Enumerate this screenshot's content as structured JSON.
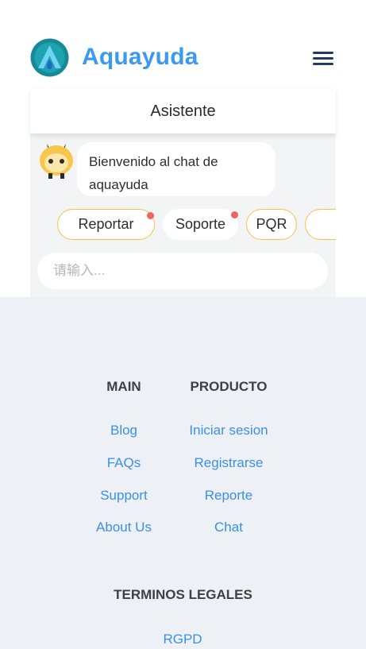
{
  "header": {
    "brand": "Aquayuda",
    "colors": {
      "brand": "#3b99f0",
      "logo": "#178a9a",
      "menu": "#1f3c5e"
    }
  },
  "chat": {
    "title": "Asistente",
    "welcome": "Bienvenido al chat de aquayuda",
    "chips": [
      {
        "label": "Reportar",
        "badge": true,
        "outlined": true
      },
      {
        "label": "Soporte",
        "badge": true,
        "outlined": false
      },
      {
        "label": "PQR",
        "badge": false,
        "outlined": true
      }
    ],
    "input_placeholder": "请输入..."
  },
  "footer": {
    "main": {
      "title": "MAIN",
      "links": [
        "Blog",
        "FAQs",
        "Support",
        "About Us"
      ]
    },
    "producto": {
      "title": "PRODUCTO",
      "links": [
        "Iniciar sesion",
        "Registrarse",
        "Reporte",
        "Chat"
      ]
    },
    "legal": {
      "title": "TERMINOS LEGALES",
      "links": [
        "RGPD"
      ]
    }
  }
}
